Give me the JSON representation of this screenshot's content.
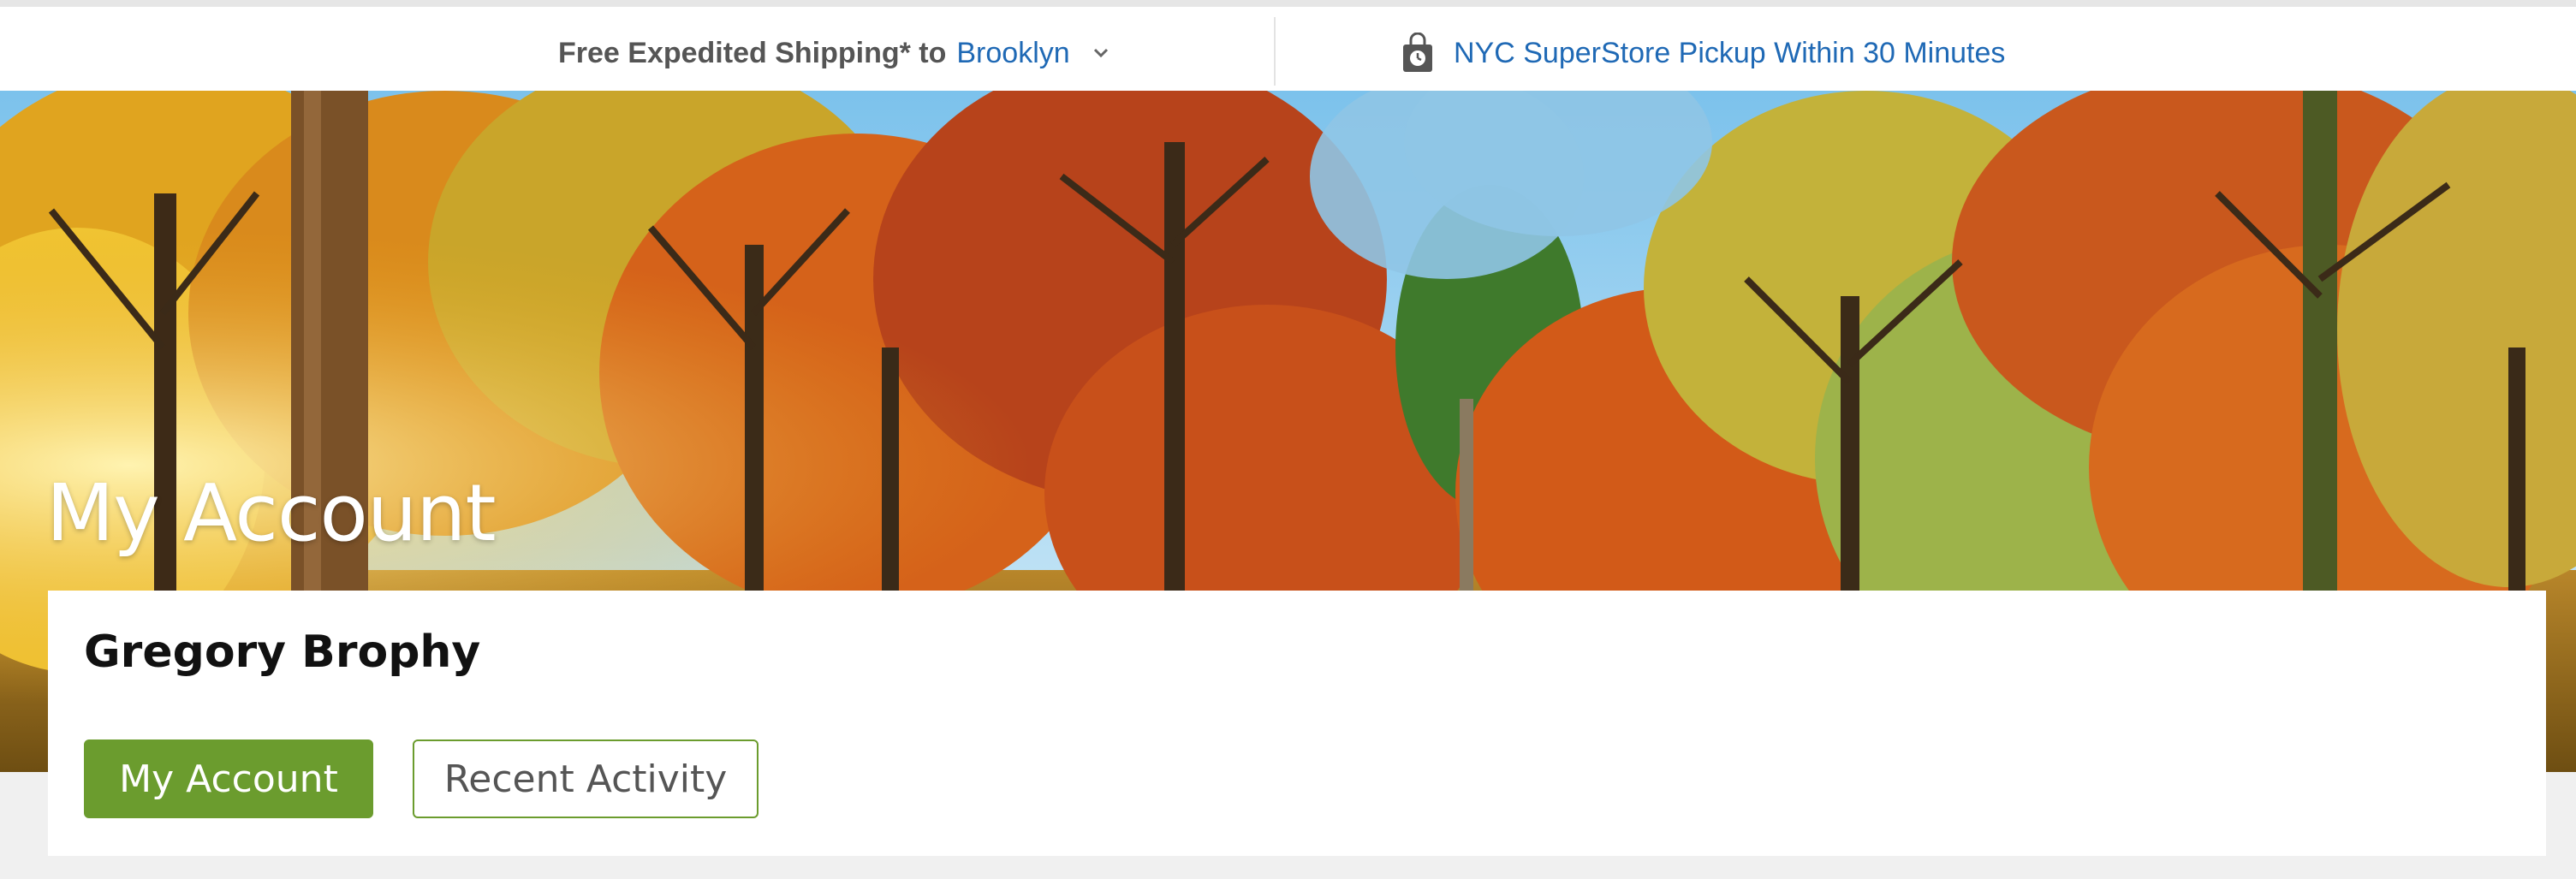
{
  "topbar": {
    "shipping_label": "Free Expedited Shipping* to",
    "shipping_city": "Brooklyn",
    "pickup_label": "NYC SuperStore Pickup Within 30 Minutes",
    "icons": {
      "location_toggle": "chevron-down-icon",
      "pickup": "shopping-bag-clock-icon"
    }
  },
  "hero": {
    "title": "My Account"
  },
  "account": {
    "user_name": "Gregory Brophy",
    "tabs": [
      {
        "label": "My Account",
        "active": true
      },
      {
        "label": "Recent Activity",
        "active": false
      }
    ]
  },
  "colors": {
    "link": "#1f69b5",
    "accent": "#6b9c2e",
    "page_bg": "#f0f0f0"
  }
}
